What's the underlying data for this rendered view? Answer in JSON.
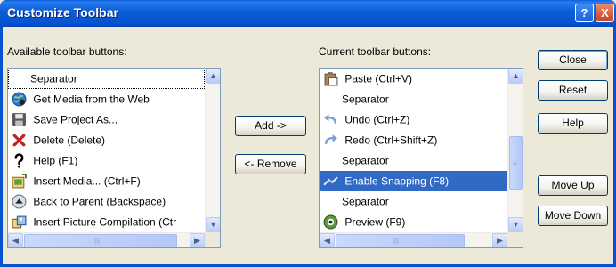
{
  "window": {
    "title": "Customize Toolbar",
    "help_glyph": "?",
    "close_glyph": "X"
  },
  "available": {
    "label": "Available toolbar buttons:",
    "items": [
      {
        "label": "Separator",
        "icon": "none"
      },
      {
        "label": "Get Media from the Web",
        "icon": "globe-icon"
      },
      {
        "label": "Save Project As...",
        "icon": "floppy-disk-icon"
      },
      {
        "label": "Delete (Delete)",
        "icon": "red-x-icon"
      },
      {
        "label": "Help (F1)",
        "icon": "question-mark-icon"
      },
      {
        "label": "Insert Media... (Ctrl+F)",
        "icon": "insert-media-icon"
      },
      {
        "label": "Back to Parent (Backspace)",
        "icon": "up-arrow-circle-icon"
      },
      {
        "label": "Insert Picture Compilation (Ctr",
        "icon": "picture-compilation-icon"
      }
    ]
  },
  "current": {
    "label": "Current toolbar buttons:",
    "items": [
      {
        "label": "Paste (Ctrl+V)",
        "icon": "clipboard-icon"
      },
      {
        "label": "Separator",
        "icon": "none"
      },
      {
        "label": "Undo (Ctrl+Z)",
        "icon": "undo-arrow-icon"
      },
      {
        "label": "Redo (Ctrl+Shift+Z)",
        "icon": "redo-arrow-icon"
      },
      {
        "label": "Separator",
        "icon": "none"
      },
      {
        "label": "Enable Snapping (F8)",
        "icon": "snap-icon"
      },
      {
        "label": "Separator",
        "icon": "none"
      },
      {
        "label": "Preview (F9)",
        "icon": "preview-icon"
      }
    ],
    "selected_index": 5
  },
  "buttons": {
    "add": "Add ->",
    "remove": "<- Remove",
    "close": "Close",
    "reset": "Reset",
    "help": "Help",
    "move_up": "Move Up",
    "move_down": "Move Down"
  },
  "colors": {
    "titlebar": "#0553D0",
    "selection": "#316AC5",
    "dialog_bg": "#ECE9D8"
  }
}
